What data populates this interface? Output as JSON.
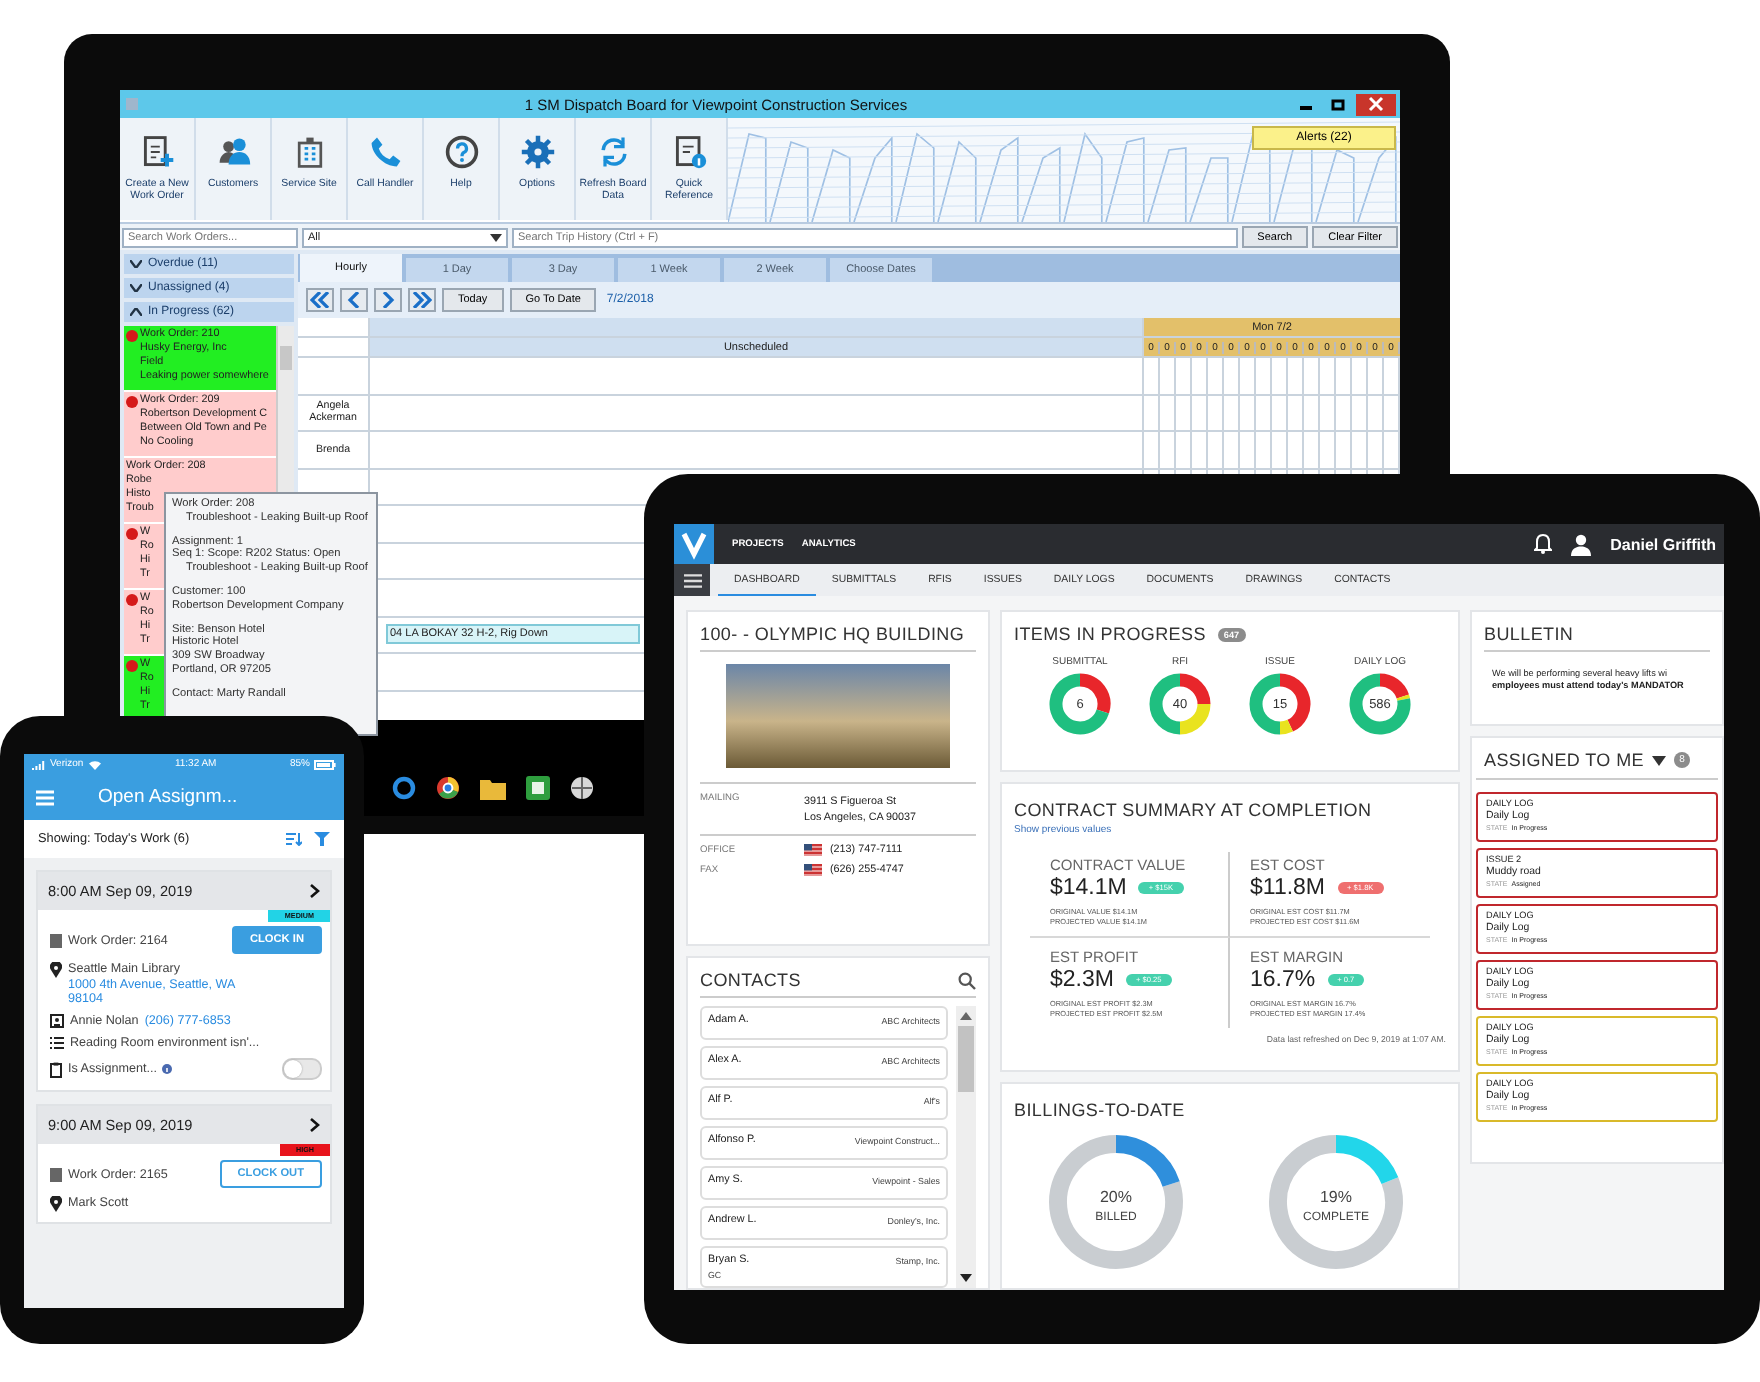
{
  "monitor": {
    "title": "1 SM Dispatch Board for Viewpoint Construction Services",
    "toolbar": [
      "Create a New Work Order",
      "Customers",
      "Service Site",
      "Call Handler",
      "Help",
      "Options",
      "Refresh Board Data",
      "Quick Reference"
    ],
    "alerts": "Alerts (22)",
    "search": {
      "placeholder": "Search Work Orders..."
    },
    "filter": {
      "value": "All"
    },
    "trip_search": {
      "placeholder": "Search Trip History (Ctrl + F)"
    },
    "buttons": [
      "Search",
      "Clear Filter"
    ],
    "groups": [
      {
        "label": "Overdue (11)",
        "expanded": false
      },
      {
        "label": "Unassigned (4)",
        "expanded": false
      },
      {
        "label": "In Progress (62)",
        "expanded": true
      }
    ],
    "work_orders": [
      {
        "color": "#22ee22",
        "flag": true,
        "lines": [
          "Work Order: 210",
          "Husky Energy, Inc",
          "Field",
          "Leaking power somewhere"
        ]
      },
      {
        "color": "#ffcccc",
        "flag": true,
        "lines": [
          "Work Order: 209",
          "Robertson Development C",
          "Between Old Town and Pe",
          "No Cooling"
        ]
      },
      {
        "color": "#ffcccc",
        "flag": false,
        "lines": [
          "Work Order: 208",
          "Robe",
          "Histo",
          "Troub"
        ]
      },
      {
        "color": "#ffcccc",
        "flag": true,
        "lines": [
          "W",
          "Ro",
          "Hi",
          "Tr"
        ]
      },
      {
        "color": "#ffcccc",
        "flag": true,
        "lines": [
          "W",
          "Ro",
          "Hi",
          "Tr"
        ]
      },
      {
        "color": "#22ee22",
        "flag": true,
        "lines": [
          "W",
          "Ro",
          "Hi",
          "Tr"
        ]
      }
    ],
    "tabs": [
      {
        "label": "Hourly",
        "selected": true
      },
      {
        "label": "1 Day",
        "selected": false
      },
      {
        "label": "3 Day",
        "selected": false
      },
      {
        "label": "1 Week",
        "selected": false
      },
      {
        "label": "2 Week",
        "selected": false
      },
      {
        "label": "Choose Dates",
        "selected": false
      }
    ],
    "nav": {
      "buttons": [
        "Today",
        "Go To Date"
      ],
      "date": "7/2/2018"
    },
    "schedule": {
      "unscheduled": "Unscheduled",
      "day": "Mon 7/2",
      "hours": [
        "0",
        "0",
        "0",
        "0",
        "0",
        "0",
        "0",
        "0",
        "0",
        "0",
        "0",
        "0",
        "0",
        "0",
        "0",
        "0"
      ],
      "technicians": [
        "Angela Ackerman",
        "Brenda"
      ],
      "booking": "04 LA BOKAY 32 H-2, Rig Down"
    },
    "tooltip": {
      "sections": [
        {
          "lines": [
            "Work Order: 208",
            "Troubleshoot - Leaking Built-up Roof"
          ]
        },
        {
          "lines": [
            "Assignment: 1",
            "Seq 1:  Scope: R202  Status: Open",
            "Troubleshoot - Leaking Built-up Roof"
          ]
        },
        {
          "lines": [
            "Customer: 100",
            "Robertson Development Company"
          ]
        },
        {
          "lines": [
            "Site: Benson Hotel",
            "Historic Hotel",
            "309 SW Broadway",
            "Portland, OR 97205"
          ]
        },
        {
          "lines": [
            "Contact: Marty Randall"
          ]
        }
      ]
    }
  },
  "tablet": {
    "top_nav": [
      "PROJECTS",
      "ANALYTICS"
    ],
    "user": "Daniel Griffith",
    "tabs": [
      {
        "label": "DASHBOARD",
        "selected": true
      },
      {
        "label": "SUBMITTALS",
        "selected": false
      },
      {
        "label": "RFIS",
        "selected": false
      },
      {
        "label": "ISSUES",
        "selected": false
      },
      {
        "label": "DAILY LOGS",
        "selected": false
      },
      {
        "label": "DOCUMENTS",
        "selected": false
      },
      {
        "label": "DRAWINGS",
        "selected": false
      },
      {
        "label": "CONTACTS",
        "selected": false
      }
    ],
    "project": {
      "title": "100- - OLYMPIC HQ BUILDING",
      "mailing": {
        "label": "MAILING",
        "lines": [
          "3911 S Figueroa St",
          "Los Angeles, CA 90037"
        ]
      },
      "phones": [
        {
          "label": "OFFICE",
          "number": "(213) 747-7111"
        },
        {
          "label": "FAX",
          "number": "(626) 255-4747"
        }
      ]
    },
    "contacts": {
      "title": "CONTACTS",
      "items": [
        {
          "name": "Adam A.",
          "company": "ABC Architects"
        },
        {
          "name": "Alex A.",
          "company": "ABC Architects"
        },
        {
          "name": "Alf P.",
          "company": "Alf's"
        },
        {
          "name": "Alfonso P.",
          "company": "Viewpoint Construct..."
        },
        {
          "name": "Amy S.",
          "company": "Viewpoint - Sales"
        },
        {
          "name": "Andrew L.",
          "company": "Donley's, Inc."
        },
        {
          "name": "Bryan S.",
          "company": "Stamp, Inc.",
          "role": "GC"
        }
      ]
    },
    "items_in_progress": {
      "title": "ITEMS IN PROGRESS",
      "count": "647",
      "items": [
        {
          "label": "SUBMITTAL",
          "count": "6"
        },
        {
          "label": "RFI",
          "count": "40"
        },
        {
          "label": "ISSUE",
          "count": "15"
        },
        {
          "label": "DAILY LOG",
          "count": "586"
        }
      ]
    },
    "contract_summary": {
      "title": "CONTRACT SUMMARY AT COMPLETION",
      "link": "Show previous values",
      "metrics": [
        {
          "label": "CONTRACT VALUE",
          "value": "$14.1M",
          "badge": {
            "text": "+ $15K",
            "color": "#45d1ad"
          },
          "lines": [
            "ORIGINAL VALUE $14.1M",
            "PROJECTED VALUE $14.1M"
          ]
        },
        {
          "label": "EST COST",
          "value": "$11.8M",
          "badge": {
            "text": "+ $1.8K",
            "color": "#ef6f6f"
          },
          "lines": [
            "ORIGINAL EST COST $11.7M",
            "PROJECTED EST COST $11.6M"
          ]
        },
        {
          "label": "EST PROFIT",
          "value": "$2.3M",
          "badge": {
            "text": "+ $0.25",
            "color": "#45d1ad"
          },
          "lines": [
            "ORIGINAL EST PROFIT $2.3M",
            "PROJECTED EST PROFIT $2.5M"
          ]
        },
        {
          "label": "EST MARGIN",
          "value": "16.7%",
          "badge": {
            "text": "+ 0.7",
            "color": "#45d1ad"
          },
          "lines": [
            "ORIGINAL EST MARGIN 16.7%",
            "PROJECTED EST MARGIN 17.4%"
          ]
        }
      ],
      "footnote": "Data last refreshed on Dec 9, 2019 at 1:07 AM."
    },
    "billings": {
      "title": "BILLINGS-TO-DATE",
      "charts": [
        {
          "value": "20%",
          "label": "BILLED",
          "color": "#2f8fdc"
        },
        {
          "value": "19%",
          "label": "COMPLETE",
          "color": "#22d6ea"
        }
      ]
    },
    "bulletin": {
      "title": "BULLETIN",
      "text": "We will be performing several heavy lifts wi",
      "notice": "employees must attend today's MANDATOR"
    },
    "assigned": {
      "title": "ASSIGNED TO ME",
      "count": "8",
      "items": [
        {
          "type": "DAILY LOG",
          "name": "Daily Log",
          "state_label": "STATE",
          "state": "In Progress",
          "color": "#c0272d"
        },
        {
          "type": "ISSUE 2",
          "name": "Muddy road",
          "state_label": "STATE",
          "state": "Assigned",
          "color": "#c0272d"
        },
        {
          "type": "DAILY LOG",
          "name": "Daily Log",
          "state_label": "STATE",
          "state": "In Progress",
          "color": "#c0272d"
        },
        {
          "type": "DAILY LOG",
          "name": "Daily Log",
          "state_label": "STATE",
          "state": "In Progress",
          "color": "#c0272d"
        },
        {
          "type": "DAILY LOG",
          "name": "Daily Log",
          "state_label": "STATE",
          "state": "In Progress",
          "color": "#d9b92a"
        },
        {
          "type": "DAILY LOG",
          "name": "Daily Log",
          "state_label": "STATE",
          "state": "In Progress",
          "color": "#d9b92a"
        }
      ]
    }
  },
  "phone": {
    "status": {
      "carrier": "Verizon",
      "time": "11:32 AM",
      "battery": "85%"
    },
    "title": "Open Assignm...",
    "showing": "Showing: Today's Work (6)",
    "assignments": [
      {
        "time": "8:00 AM Sep 09, 2019",
        "priority": {
          "label": "MEDIUM",
          "color": "#22d3e6"
        },
        "work_order": "Work Order: 2164",
        "action": {
          "label": "CLOCK IN",
          "kind": "primary"
        },
        "site": "Seattle Main Library",
        "address": "1000 4th Avenue, Seattle, WA 98104",
        "contact": "Annie Nolan",
        "contact_phone": "(206) 777-6853",
        "description": "Reading Room environment isn'...",
        "question": "Is Assignment...",
        "toggle_on": false
      },
      {
        "time": "9:00 AM Sep 09, 2019",
        "priority": {
          "label": "HIGH",
          "color": "#e8141c"
        },
        "work_order": "Work Order: 2165",
        "action": {
          "label": "CLOCK OUT",
          "kind": "outline"
        },
        "site": "Mark Scott"
      }
    ]
  }
}
